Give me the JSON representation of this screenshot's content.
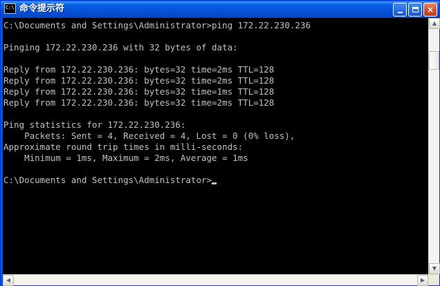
{
  "window": {
    "title": "命令提示符",
    "icon_label": "C:\\",
    "colors": {
      "titlebar": "#0054e3",
      "console_background": "#000000",
      "console_text": "#c0c0c0",
      "close_button": "#d9542f"
    }
  },
  "titlebar_buttons": {
    "minimize_icon": "minimize-icon",
    "maximize_icon": "maximize-icon",
    "close_icon": "close-icon",
    "close_glyph": "×"
  },
  "console": {
    "lines": [
      "C:\\Documents and Settings\\Administrator>ping 172.22.230.236",
      "",
      "Pinging 172.22.230.236 with 32 bytes of data:",
      "",
      "Reply from 172.22.230.236: bytes=32 time=2ms TTL=128",
      "Reply from 172.22.230.236: bytes=32 time=2ms TTL=128",
      "Reply from 172.22.230.236: bytes=32 time=1ms TTL=128",
      "Reply from 172.22.230.236: bytes=32 time=2ms TTL=128",
      "",
      "Ping statistics for 172.22.230.236:",
      "    Packets: Sent = 4, Received = 4, Lost = 0 (0% loss),",
      "Approximate round trip times in milli-seconds:",
      "    Minimum = 1ms, Maximum = 2ms, Average = 1ms",
      "",
      "C:\\Documents and Settings\\Administrator>"
    ]
  },
  "scrollbars": {
    "up_arrow": "▲",
    "down_arrow": "▼",
    "left_arrow": "◀",
    "right_arrow": "▶"
  }
}
